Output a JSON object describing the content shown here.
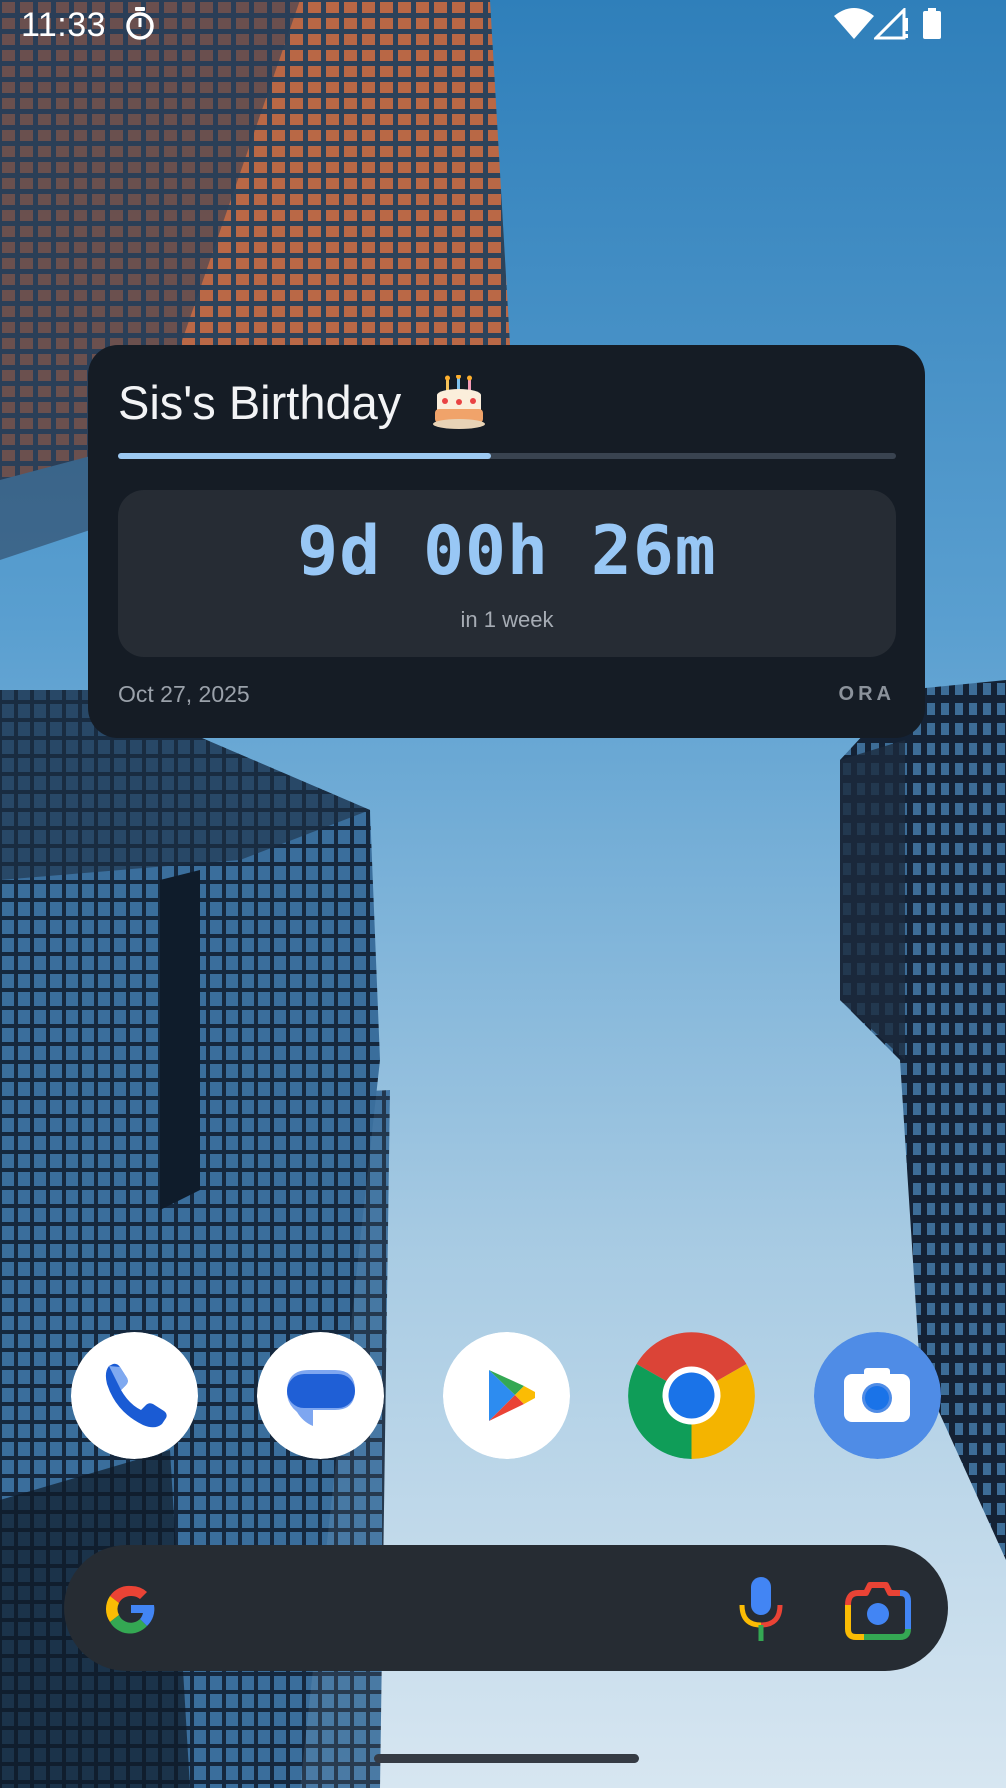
{
  "status_bar": {
    "time": "11:33",
    "icons": [
      "timer-icon",
      "wifi-icon",
      "signal-icon",
      "battery-icon"
    ]
  },
  "widget": {
    "title": "Sis's Birthday",
    "title_icon": "cake-icon",
    "progress_fraction": 0.48,
    "countdown": "9d 00h 26m",
    "relative": "in 1 week",
    "date": "Oct 27, 2025",
    "brand": "ORA",
    "colors": {
      "background": "#151c25",
      "accent": "#98c7f5",
      "panel": "#262c34"
    }
  },
  "dock": {
    "apps": [
      {
        "name": "Phone",
        "icon": "phone-icon"
      },
      {
        "name": "Messages",
        "icon": "messages-icon"
      },
      {
        "name": "Play Store",
        "icon": "play-store-icon"
      },
      {
        "name": "Chrome",
        "icon": "chrome-icon"
      },
      {
        "name": "Camera",
        "icon": "camera-icon"
      }
    ]
  },
  "search": {
    "placeholder": "",
    "icons": [
      "google-g-icon",
      "microphone-icon",
      "google-lens-icon"
    ]
  }
}
